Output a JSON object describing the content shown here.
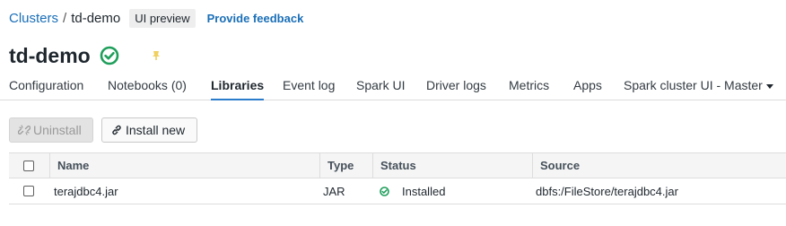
{
  "breadcrumb": {
    "parent": "Clusters",
    "separator": "/",
    "current": "td-demo"
  },
  "preview_badge": "UI preview",
  "feedback_link": "Provide feedback",
  "cluster": {
    "name": "td-demo",
    "status_icon": "check-circle-icon",
    "pin_icon": "pin-icon"
  },
  "tabs": [
    {
      "label": "Configuration",
      "active": false
    },
    {
      "label": "Notebooks (0)",
      "active": false
    },
    {
      "label": "Libraries",
      "active": true
    },
    {
      "label": "Event log",
      "active": false
    },
    {
      "label": "Spark UI",
      "active": false
    },
    {
      "label": "Driver logs",
      "active": false
    },
    {
      "label": "Metrics",
      "active": false
    },
    {
      "label": "Apps",
      "active": false
    },
    {
      "label": "Spark cluster UI - Master",
      "active": false,
      "dropdown": true
    }
  ],
  "toolbar": {
    "uninstall_label": "Uninstall",
    "uninstall_enabled": false,
    "install_label": "Install new"
  },
  "table": {
    "columns": [
      "Name",
      "Type",
      "Status",
      "Source"
    ],
    "rows": [
      {
        "name": "terajdbc4.jar",
        "type": "JAR",
        "status": "Installed",
        "source": "dbfs:/FileStore/terajdbc4.jar",
        "checked": false
      }
    ]
  },
  "colors": {
    "accent": "#2b7ccb",
    "link": "#1a6fb8",
    "success": "#1e9e5a",
    "pin": "#f0d060"
  }
}
